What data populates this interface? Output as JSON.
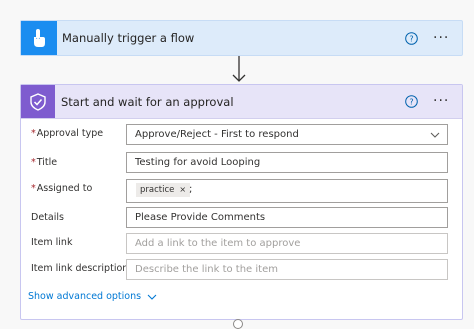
{
  "trigger": {
    "title": "Manually trigger a flow",
    "more": "···",
    "icon": "touch-hand-icon",
    "accent": "#1b8df0"
  },
  "approval": {
    "title": "Start and wait for an approval",
    "more": "···",
    "icon": "approval-check-icon",
    "accent": "#7e5ccf",
    "fields": {
      "approval_type": {
        "label": "Approval type",
        "required": "*",
        "value": "Approve/Reject - First to respond"
      },
      "title": {
        "label": "Title",
        "required": "*",
        "value": "Testing for avoid Looping"
      },
      "assigned_to": {
        "label": "Assigned to",
        "required": "*",
        "token": "practice",
        "token_remove": "×",
        "separator": ";"
      },
      "details": {
        "label": "Details",
        "value": "Please Provide Comments"
      },
      "item_link": {
        "label": "Item link",
        "placeholder": "Add a link to the item to approve"
      },
      "item_link_description": {
        "label": "Item link description",
        "placeholder": "Describe the link to the item"
      }
    },
    "advanced_link": "Show advanced options"
  }
}
